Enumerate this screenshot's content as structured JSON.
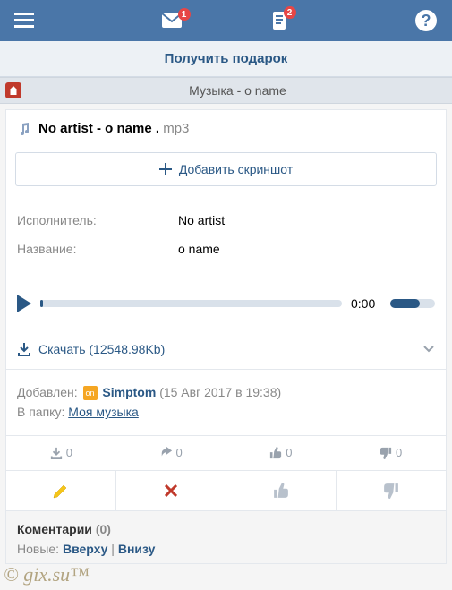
{
  "header": {
    "mail_badge": "1",
    "doc_badge": "2"
  },
  "gift": {
    "label": "Получить подарок"
  },
  "breadcrumb": {
    "title": "Музыка - o name"
  },
  "track": {
    "title_bold": "No artist - o name .",
    "ext": " mp3"
  },
  "add_screenshot": {
    "label": "Добавить скриншот"
  },
  "meta": {
    "artist_label": "Исполнитель:",
    "artist_value": "No artist",
    "name_label": "Название:",
    "name_value": "o name"
  },
  "player": {
    "time": "0:00"
  },
  "download": {
    "label": "Скачать (12548.98Kb)"
  },
  "added": {
    "added_label": "Добавлен:",
    "on_badge": "on",
    "user": "Simptom",
    "date": "(15 Авг 2017 в 19:38)",
    "folder_label": "В папку:",
    "folder_value": "Моя музыка"
  },
  "stats": {
    "downloads": "0",
    "shares": "0",
    "likes": "0",
    "dislikes": "0"
  },
  "comments": {
    "title": "Коментарии",
    "count": "(0)",
    "new_label": "Новые:",
    "top": "Вверху",
    "sep": " | ",
    "bottom": "Внизу"
  },
  "watermark": "© gix.su™"
}
